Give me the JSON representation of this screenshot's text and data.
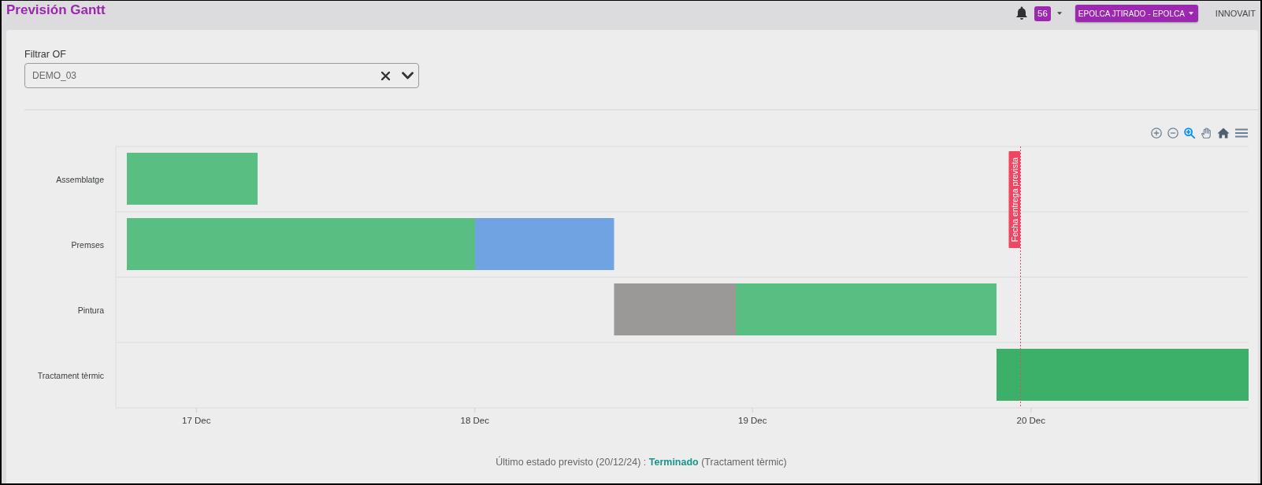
{
  "header": {
    "title": "Previsión Gantt",
    "notifications": {
      "count": "56"
    },
    "user_menu": {
      "label": "EPOLCA JTIRADO - EPOLCA"
    },
    "company": "INNOVAIT"
  },
  "filter": {
    "label": "Filtrar OF",
    "value": "DEMO_03"
  },
  "toolbar": [
    {
      "kind": "zoom_in",
      "selected": false
    },
    {
      "kind": "zoom_out",
      "selected": false
    },
    {
      "kind": "selection_zoom",
      "selected": true
    },
    {
      "kind": "pan",
      "selected": false
    },
    {
      "kind": "reset",
      "selected": false
    },
    {
      "kind": "menu",
      "selected": false
    }
  ],
  "gantt": {
    "rows": [
      {
        "label": "Assemblatge",
        "tasks": [
          {
            "color": "#58be82"
          }
        ]
      },
      {
        "label": "Premses",
        "tasks": [
          {
            "color": "#58be82"
          },
          {
            "color": "#6fa3e2"
          }
        ]
      },
      {
        "label": "Pintura",
        "tasks": [
          {
            "color": "#9b9997"
          },
          {
            "color": "#58be82"
          }
        ]
      },
      {
        "label": "Tractament tèrmic",
        "tasks": [
          {
            "color": "#3cb068"
          }
        ]
      }
    ],
    "axis_labels": [
      "17 Dec",
      "18 Dec",
      "19 Dec",
      "20 Dec"
    ],
    "deadline": {
      "label": "Fecha entrega prevista"
    }
  },
  "status": {
    "text": "Último estado previsto (20/12/24) : **Terminado** (Tractament tèrmic)"
  }
}
